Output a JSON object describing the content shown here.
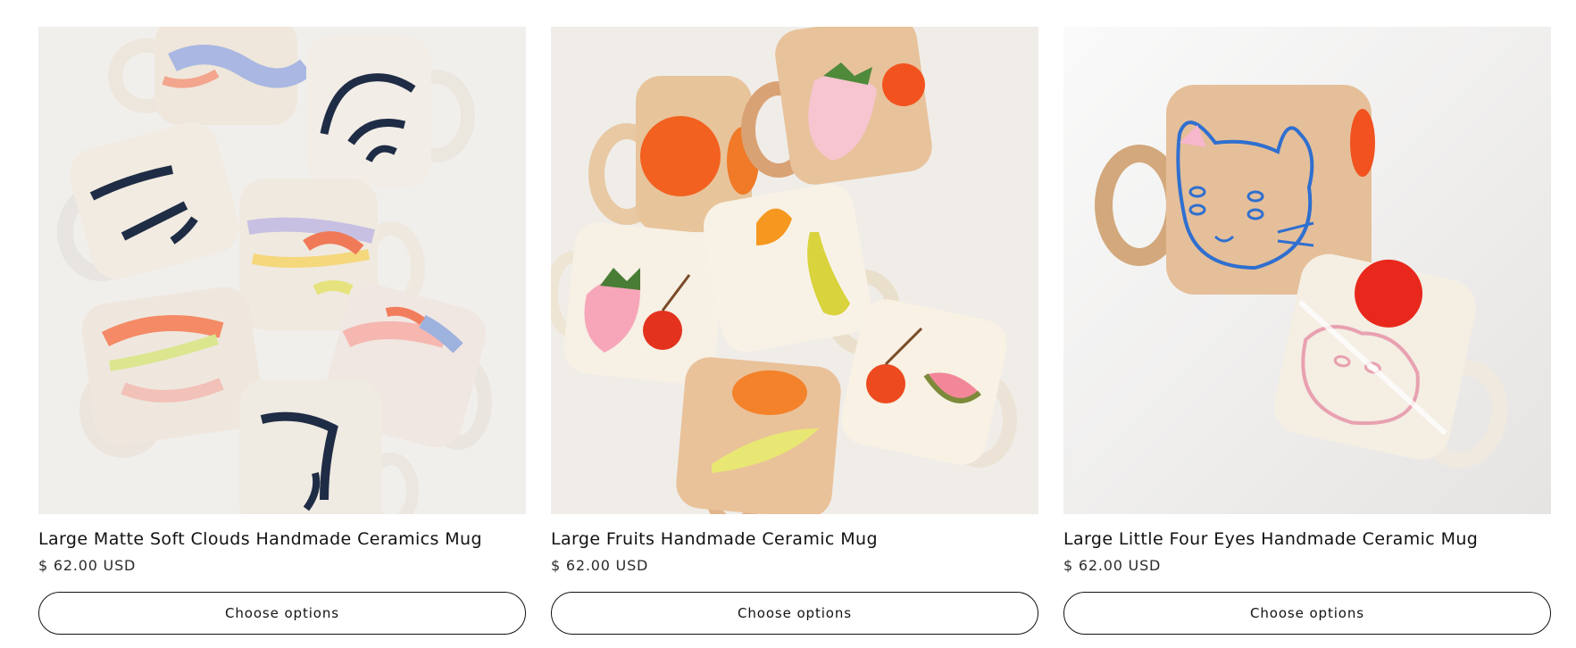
{
  "products": [
    {
      "title": "Large Matte Soft Clouds Handmade Ceramics Mug",
      "price": "$ 62.00 USD",
      "button_label": "Choose options",
      "image_alt": "Speckled ceramic mugs with soft pastel clouds and navy brush strokes"
    },
    {
      "title": "Large Fruits Handmade Ceramic Mug",
      "price": "$ 62.00 USD",
      "button_label": "Choose options",
      "image_alt": "Ceramic mugs painted with strawberries, oranges, bananas, cherries and watermelon"
    },
    {
      "title": "Large Little Four Eyes Handmade Ceramic Mug",
      "price": "$ 62.00 USD",
      "button_label": "Choose options",
      "image_alt": "Ceramic mugs painted with a blue four-eyed cat face and a pink face"
    }
  ],
  "colors": {
    "text": "#121212",
    "button_border": "#121212",
    "background": "#ffffff"
  }
}
